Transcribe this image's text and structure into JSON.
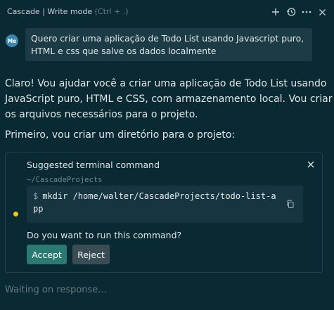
{
  "header": {
    "title": "Cascade | Write mode",
    "mode_hint": "(Ctrl + .)",
    "icons": [
      "plus-icon",
      "history-icon",
      "more-icon",
      "close-icon"
    ]
  },
  "user_message": {
    "avatar": "Me",
    "text": "Quero criar uma aplicação de Todo List usando Javascript puro, HTML e css que salve os dados localmente"
  },
  "assistant": {
    "paragraph_1": "Claro! Vou ajudar você a criar uma aplicação de Todo List usando JavaScript puro, HTML e CSS, com armazenamento local. Vou criar os arquivos necessários para o projeto.",
    "paragraph_2": "Primeiro, vou criar um diretório para o projeto:"
  },
  "terminal_card": {
    "title": "Suggested terminal command",
    "cwd": "~/CascadeProjects",
    "prompt_symbol": "$",
    "command": "mkdir /home/walter/CascadeProjects/todo-list-app",
    "question": "Do you want to run this command?",
    "accept_label": "Accept",
    "reject_label": "Reject",
    "status_color": "#f5c518"
  },
  "footer": {
    "status_text": "Waiting on response..."
  },
  "colors": {
    "background": "#0a2a33",
    "accent": "#2a7a72",
    "avatar": "#3a87b4"
  }
}
